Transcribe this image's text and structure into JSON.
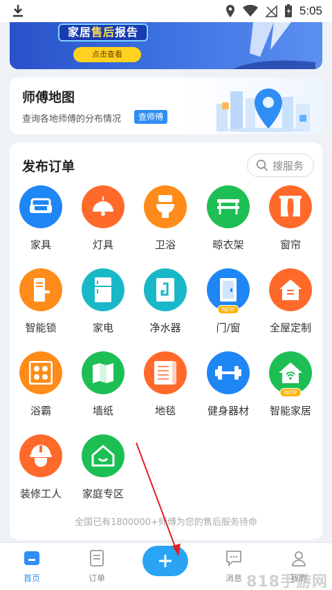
{
  "status_bar": {
    "time": "5:05"
  },
  "banner": {
    "title_prefix": "家居",
    "title_highlight": "售后",
    "title_suffix": "报告",
    "button_label": "点击查看"
  },
  "map_card": {
    "title": "师傅地图",
    "description": "查询各地师傅的分布情况",
    "tag": "查师傅"
  },
  "order_section": {
    "title": "发布订单",
    "search_placeholder": "搜服务",
    "items": [
      {
        "label": "家具",
        "icon": "sofa-icon",
        "color": "#1f86f5"
      },
      {
        "label": "灯具",
        "icon": "lamp-icon",
        "color": "#ff6a2b"
      },
      {
        "label": "卫浴",
        "icon": "toilet-icon",
        "color": "#ff8c1a"
      },
      {
        "label": "晾衣架",
        "icon": "clothes-rack-icon",
        "color": "#1dbf54"
      },
      {
        "label": "窗帘",
        "icon": "curtain-icon",
        "color": "#ff6a2b"
      },
      {
        "label": "智能锁",
        "icon": "smart-lock-icon",
        "color": "#ff8c1a"
      },
      {
        "label": "家电",
        "icon": "fridge-icon",
        "color": "#19b8c8"
      },
      {
        "label": "净水器",
        "icon": "water-purifier-icon",
        "color": "#19b8c8"
      },
      {
        "label": "门/窗",
        "icon": "door-icon",
        "color": "#1f86f5",
        "badge": "NEW"
      },
      {
        "label": "全屋定制",
        "icon": "house-icon",
        "color": "#ff6a2b"
      },
      {
        "label": "浴霸",
        "icon": "bath-heater-icon",
        "color": "#ff8c1a"
      },
      {
        "label": "墙纸",
        "icon": "wallpaper-icon",
        "color": "#1dbf54"
      },
      {
        "label": "地毯",
        "icon": "carpet-icon",
        "color": "#ff6a2b"
      },
      {
        "label": "健身器材",
        "icon": "dumbbell-icon",
        "color": "#1f86f5"
      },
      {
        "label": "智能家居",
        "icon": "smart-home-icon",
        "color": "#1dbf54",
        "badge": "NEW"
      },
      {
        "label": "装修工人",
        "icon": "worker-helmet-icon",
        "color": "#ff6a2b"
      },
      {
        "label": "家庭专区",
        "icon": "home-smile-icon",
        "color": "#1dbf54"
      }
    ],
    "footer_note": "全国已有1800000+师傅为您的售后服务待命"
  },
  "bottom_nav": {
    "items": [
      {
        "label": "首页",
        "icon": "home-icon",
        "active": true
      },
      {
        "label": "订单",
        "icon": "order-icon",
        "active": false
      },
      {
        "label": "消息",
        "icon": "message-icon",
        "active": false
      },
      {
        "label": "我的",
        "icon": "profile-icon",
        "active": false
      }
    ],
    "add_icon": "plus-icon",
    "accent_color": "#2f8df4"
  },
  "watermark": "818手游网"
}
